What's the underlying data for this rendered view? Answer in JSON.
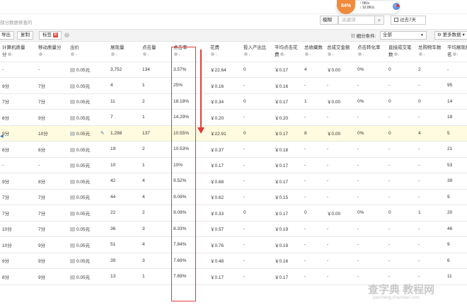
{
  "top": {
    "percent": "84%",
    "up_speed": "0K/s",
    "down_speed": "10.8K/s",
    "up_arrow": "↑",
    "down_arrow": "↓"
  },
  "breadcrumb_hint": "部分数据排查的",
  "search": {
    "mode": "模糊",
    "placeholder": "关键词",
    "search_icon": "⌕"
  },
  "date_range": "过去7天",
  "toolbar": {
    "export_label": "导出",
    "copy_label": "复制",
    "tag_label": "标签",
    "tag_badge": "新",
    "filter_label": "细分条件:",
    "filter_value": "全部",
    "more_data_label": "更多数据"
  },
  "columns": [
    {
      "line1": "计算机质量",
      "line2": "分",
      "sort": true
    },
    {
      "line1": "移动质量分",
      "line2": "",
      "sort": true
    },
    {
      "line1": "出价",
      "line2": "",
      "sort": true
    },
    {
      "line1": "",
      "line2": "",
      "sort": false
    },
    {
      "line1": "展现量",
      "line2": "",
      "sort": true
    },
    {
      "line1": "点击量",
      "line2": "",
      "sort": true
    },
    {
      "line1": "点击率",
      "line2": "",
      "sort": true
    },
    {
      "line1": "",
      "line2": "",
      "sort": false
    },
    {
      "line1": "花费",
      "line2": "",
      "sort": true
    },
    {
      "line1": "投入产出比",
      "line2": "",
      "sort": true
    },
    {
      "line1": "平均点击花",
      "line2": "费",
      "sort": true
    },
    {
      "line1": "总收藏数",
      "line2": "",
      "sort": true
    },
    {
      "line1": "总成交金额",
      "line2": "",
      "sort": true
    },
    {
      "line1": "点击转化率",
      "line2": "",
      "sort": true
    },
    {
      "line1": "直接成交笔",
      "line2": "数",
      "sort": true
    },
    {
      "line1": "总购物车数",
      "line2": "",
      "sort": true
    },
    {
      "line1": "平均展现排",
      "line2": "名",
      "sort": true
    }
  ],
  "rows": [
    [
      "-",
      "-",
      "0.05元",
      "",
      "3,752",
      "134",
      "3.57%",
      "",
      "￥22.64",
      "0",
      "￥0.17",
      "4",
      "￥0.00",
      "0%",
      "0",
      "2",
      "-"
    ],
    [
      "9分",
      "7分",
      "0.05元",
      "",
      "4",
      "1",
      "25%",
      "",
      "￥0.16",
      "-",
      "￥0.16",
      "-",
      "-",
      "-",
      "-",
      "-",
      "95"
    ],
    [
      "7分",
      "7分",
      "0.05元",
      "",
      "11",
      "2",
      "18.18%",
      "",
      "￥0.34",
      "0",
      "￥0.17",
      "1",
      "￥0.00",
      "0%",
      "0",
      "0",
      "14"
    ],
    [
      "8分",
      "9分",
      "0.05元",
      "",
      "7",
      "1",
      "14.29%",
      "",
      "￥0.20",
      "-",
      "￥0.20",
      "-",
      "-",
      "-",
      "-",
      "-",
      "18"
    ],
    [
      "9分",
      "10分",
      "0.05元",
      "✎",
      "1,298",
      "137",
      "10.55%",
      "",
      "￥22.91",
      "0",
      "￥0.17",
      "8",
      "￥0.00",
      "0%",
      "0",
      "4",
      "5"
    ],
    [
      "8分",
      "6分",
      "0.05元",
      "",
      "19",
      "2",
      "10.53%",
      "",
      "￥0.37",
      "-",
      "￥0.18",
      "-",
      "-",
      "-",
      "-",
      "-",
      "21"
    ],
    [
      "-",
      "-",
      "0.05元",
      "",
      "10",
      "1",
      "10%",
      "",
      "￥0.17",
      "-",
      "￥0.17",
      "-",
      "-",
      "-",
      "-",
      "-",
      "53"
    ],
    [
      "9分",
      "8分",
      "0.05元",
      "",
      "42",
      "4",
      "9.52%",
      "",
      "￥0.68",
      "-",
      "￥0.17",
      "-",
      "-",
      "-",
      "-",
      "-",
      "39"
    ],
    [
      "7分",
      "7分",
      "0.05元",
      "",
      "44",
      "4",
      "9.09%",
      "",
      "￥0.62",
      "-",
      "￥0.15",
      "-",
      "-",
      "-",
      "-",
      "-",
      "9"
    ],
    [
      "7分",
      "7分",
      "0.05元",
      "",
      "22",
      "2",
      "9.09%",
      "",
      "￥0.33",
      "0",
      "￥0.17",
      "0",
      "￥0.00",
      "0%",
      "0",
      "1",
      "20"
    ],
    [
      "10分",
      "7分",
      "0.05元",
      "",
      "36",
      "3",
      "8.33%",
      "",
      "￥0.57",
      "-",
      "￥0.19",
      "-",
      "-",
      "-",
      "-",
      "-",
      "46"
    ],
    [
      "10分",
      "9分",
      "0.05元",
      "",
      "51",
      "4",
      "7.84%",
      "",
      "￥0.76",
      "-",
      "￥0.19",
      "-",
      "-",
      "-",
      "-",
      "-",
      "9"
    ],
    [
      "9分",
      "9分",
      "0.05元",
      "",
      "39",
      "3",
      "7.69%",
      "",
      "￥0.48",
      "-",
      "￥0.16",
      "-",
      "-",
      "-",
      "-",
      "-",
      "6"
    ],
    [
      "8分",
      "9分",
      "0.05元",
      "",
      "13",
      "1",
      "7.69%",
      "",
      "￥0.17",
      "-",
      "￥0.17",
      "-",
      "-",
      "-",
      "-",
      "-",
      "11"
    ]
  ],
  "highlight_row": 4,
  "watermark": "查字典 教程网",
  "watermark_url": "jiaocheng.chazidian.com",
  "colors": {
    "accent_red": "#e23b3b",
    "badge_orange": "#f08a3c",
    "highlight_row_bg": "#fffbe0",
    "link_blue": "#2a6ac8"
  }
}
